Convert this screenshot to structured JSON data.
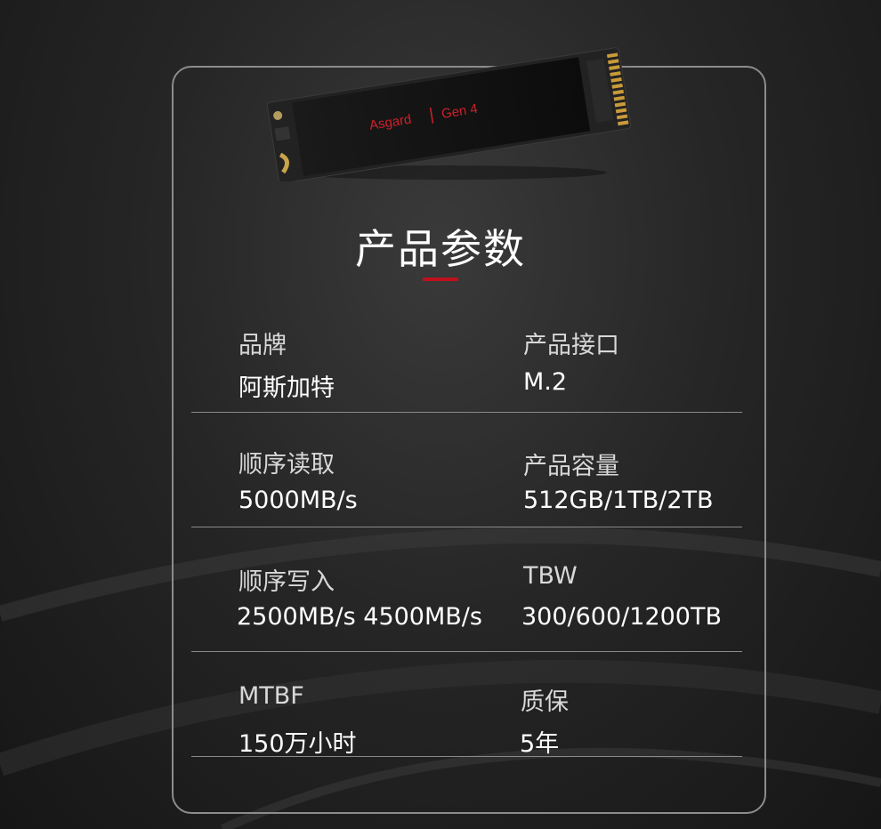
{
  "product": {
    "brand_mark": "Asgard",
    "gen_mark": "Gen 4"
  },
  "title": "产品参数",
  "colors": {
    "accent": "#c0101c",
    "text": "#ffffff",
    "line": "#8a8a8a"
  },
  "specs": [
    {
      "label": "品牌",
      "value": "阿斯加特"
    },
    {
      "label": "产品接口",
      "value": "M.2"
    },
    {
      "label": "顺序读取",
      "value": "5000MB/s"
    },
    {
      "label": "产品容量",
      "value": "512GB/1TB/2TB"
    },
    {
      "label": "顺序写入",
      "value": "2500MB/s 4500MB/s"
    },
    {
      "label": "TBW",
      "value": "300/600/1200TB"
    },
    {
      "label": "MTBF",
      "value": "150万小时"
    },
    {
      "label": "质保",
      "value": "5年"
    }
  ]
}
